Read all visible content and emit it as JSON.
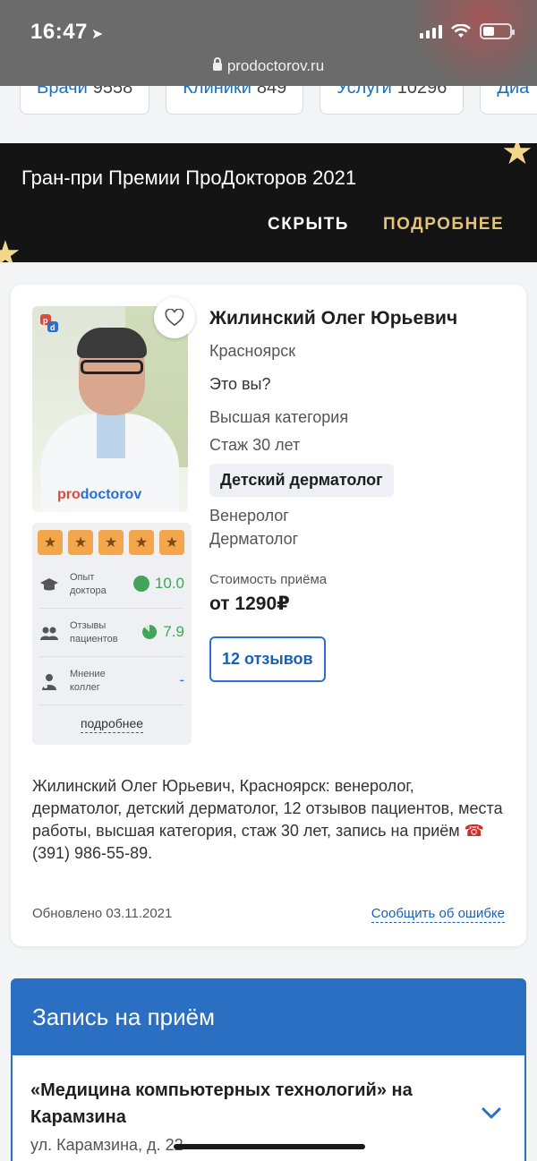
{
  "status": {
    "time": "16:47",
    "url": "prodoctorov.ru"
  },
  "nav_pills": [
    {
      "label": "Врачи",
      "count": "9558"
    },
    {
      "label": "Клиники",
      "count": "849"
    },
    {
      "label": "Услуги",
      "count": "10296"
    },
    {
      "label": "Диа",
      "count": ""
    }
  ],
  "banner": {
    "title": "Гран-при Премии ПроДокторов 2021",
    "hide_label": "СКРЫТЬ",
    "more_label": "ПОДРОБНЕЕ"
  },
  "doctor": {
    "name": "Жилинский Олег Юрьевич",
    "city": "Красноярск",
    "its_you": "Это вы?",
    "category": "Высшая категория",
    "experience": "Стаж 30 лет",
    "main_specialty": "Детский дерматолог",
    "specialties": [
      "Венеролог",
      "Дерматолог"
    ],
    "price_label": "Стоимость приёма",
    "price": "от 1290₽",
    "reviews_button": "12 отзывов",
    "photo_brand": {
      "pro": "pro",
      "doctorov": "doctorov"
    }
  },
  "rating": {
    "stars": 5,
    "rows": [
      {
        "label": "Опыт доктора",
        "value": "10.0",
        "icon": "graduation-cap-icon"
      },
      {
        "label": "Отзывы пациентов",
        "value": "7.9",
        "icon": "patients-icon"
      },
      {
        "label": "Мнение коллег",
        "value": "-",
        "icon": "doctor-icon"
      }
    ],
    "more": "подробнее"
  },
  "description": {
    "text": "Жилинский Олег Юрьевич, Красноярск: венеролог, дерматолог, детский дерматолог, 12 отзывов пациентов, места работы, высшая категория, стаж 30 лет, запись на приём",
    "phone": "(391) 986-55-89."
  },
  "updated": "Обновлено 03.11.2021",
  "report_error": "Сообщить об ошибке",
  "booking": {
    "title": "Запись на приём",
    "clinic_name": "«Медицина компьютерных технологий» на Карамзина",
    "clinic_address": "ул. Карамзина, д. 22"
  },
  "colors": {
    "accent": "#2a6fc2",
    "gold": "#e3c27a",
    "star": "#f4a64d",
    "green": "#43a55b"
  }
}
